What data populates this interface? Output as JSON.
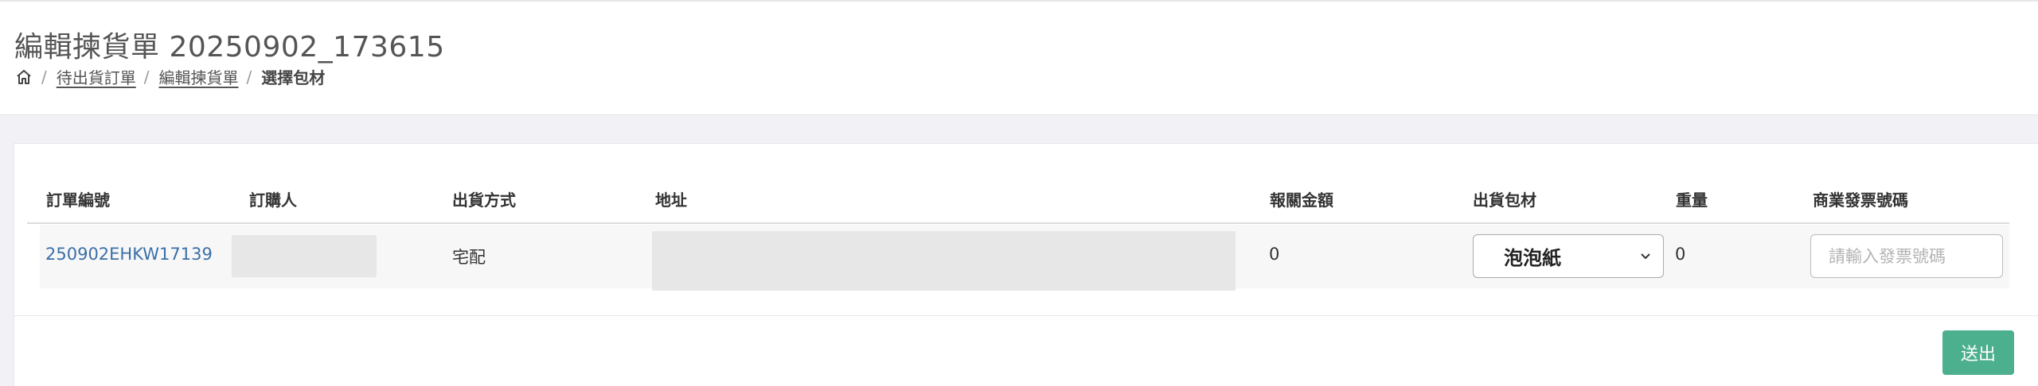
{
  "header": {
    "title": "編輯揀貨單 20250902_173615",
    "breadcrumb": {
      "home_icon": "home-icon",
      "items": [
        "待出貨訂單",
        "編輯揀貨單"
      ],
      "current": "選擇包材"
    }
  },
  "table": {
    "columns": [
      "訂單編號",
      "訂購人",
      "出貨方式",
      "地址",
      "報關金額",
      "出貨包材",
      "重量",
      "商業發票號碼"
    ],
    "rows": [
      {
        "order_no": "250902EHKW17139",
        "buyer": "",
        "shipping": "宅配",
        "address": "",
        "customs_amount": "0",
        "packaging": "泡泡紙",
        "weight": "0",
        "invoice_placeholder": "請輸入發票號碼"
      }
    ]
  },
  "actions": {
    "submit_label": "送出"
  },
  "colors": {
    "accent": "#4caf8e",
    "link": "#3a6fa8"
  }
}
